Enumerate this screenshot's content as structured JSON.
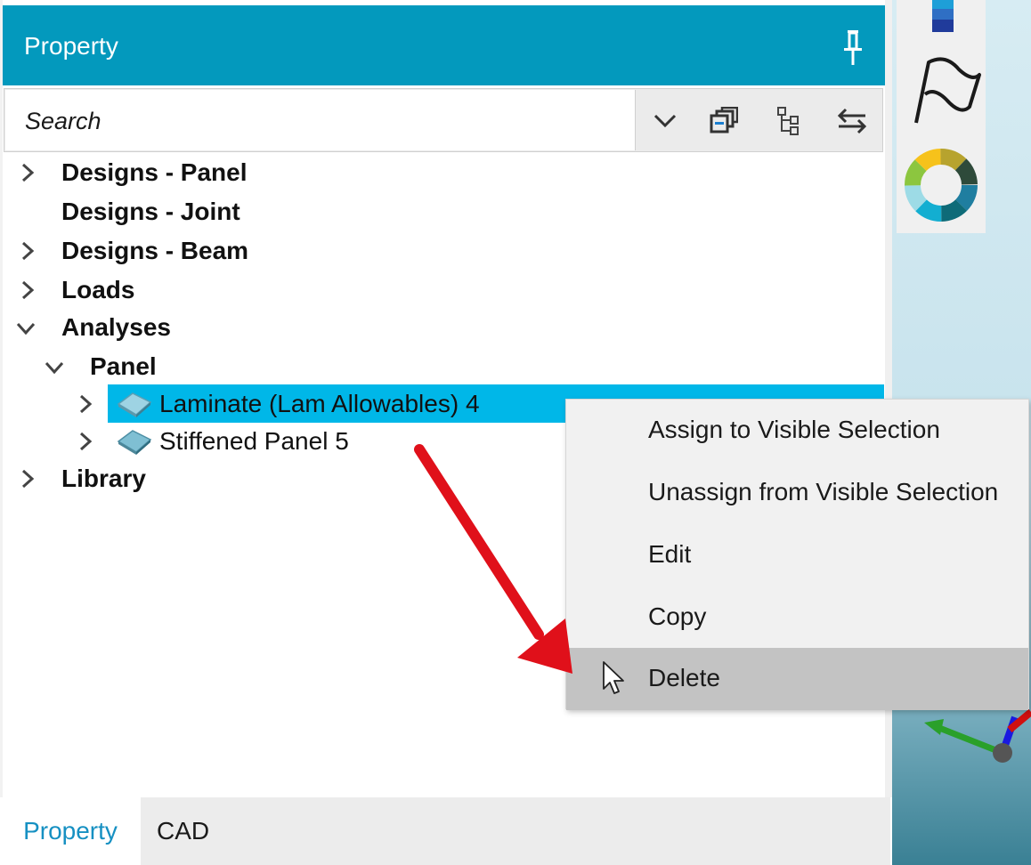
{
  "panel": {
    "title": "Property",
    "pin_icon": "pin-icon",
    "accent_color": "#0399bd"
  },
  "search": {
    "placeholder": "Search"
  },
  "toolbar": {
    "icons": [
      "chevron-down-icon",
      "collapse-all-icon",
      "tree-view-icon",
      "swap-icon"
    ]
  },
  "tree": {
    "items": [
      {
        "label": "Designs - Panel",
        "expanded": false,
        "has_children": true
      },
      {
        "label": "Designs - Joint",
        "has_children": false
      },
      {
        "label": "Designs - Beam",
        "expanded": false,
        "has_children": true
      },
      {
        "label": "Loads",
        "expanded": false,
        "has_children": true
      },
      {
        "label": "Analyses",
        "expanded": true,
        "has_children": true
      },
      {
        "label": "Panel",
        "expanded": true,
        "has_children": true
      },
      {
        "label": "Laminate (Lam Allowables) 4",
        "expanded": false,
        "selected": true,
        "icon": "laminate-icon"
      },
      {
        "label": "Stiffened Panel 5",
        "expanded": false,
        "icon": "laminate-icon"
      },
      {
        "label": "Library",
        "expanded": false,
        "has_children": true
      }
    ],
    "selection_color": "#00b7e8"
  },
  "context_menu": {
    "items": [
      {
        "label": "Assign to Visible Selection"
      },
      {
        "label": "Unassign from Visible Selection"
      },
      {
        "label": "Edit"
      },
      {
        "label": "Copy"
      },
      {
        "label": "Delete",
        "hovered": true
      }
    ]
  },
  "tabs": [
    {
      "label": "Property",
      "active": true
    },
    {
      "label": "CAD",
      "active": false
    }
  ],
  "annotation": {
    "arrow_color": "#e0101a"
  }
}
